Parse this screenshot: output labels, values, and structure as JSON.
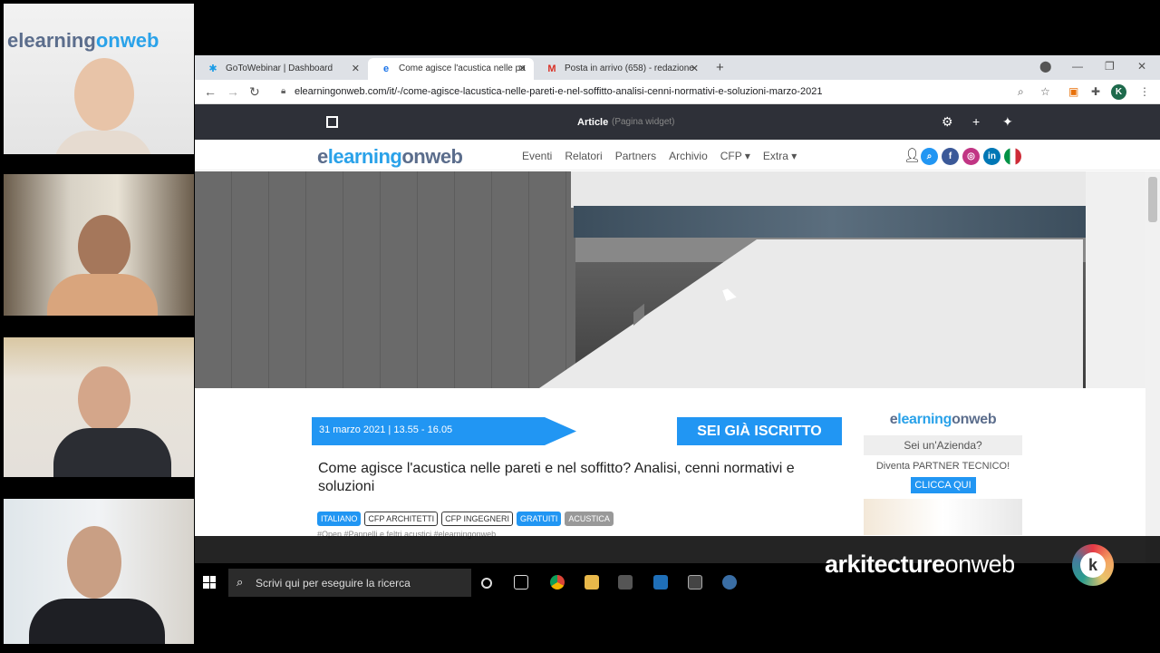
{
  "browser": {
    "tabs": [
      {
        "label": "GoToWebinar | Dashboard",
        "active": false
      },
      {
        "label": "Come agisce l'acustica nelle pa",
        "active": true
      },
      {
        "label": "Posta in arrivo (658) - redazione",
        "active": false
      }
    ],
    "url": "elearningonweb.com/it/-/come-agisce-lacustica-nelle-pareti-e-nel-soffitto-analisi-cenni-normativi-e-soluzioni-marzo-2021",
    "avatar_letter": "K"
  },
  "wp_toolbar": {
    "title": "Article",
    "subtitle": "(Pagina widget)"
  },
  "site": {
    "logo": {
      "part1": "e",
      "part2": "learning",
      "part3": "onweb"
    },
    "menu": [
      "Eventi",
      "Relatori",
      "Partners",
      "Archivio",
      "CFP ▾",
      "Extra ▾"
    ],
    "social": [
      {
        "name": "search-icon",
        "glyph": "⌕",
        "color": "#2196f3"
      },
      {
        "name": "facebook-icon",
        "glyph": "f",
        "color": "#3b5998"
      },
      {
        "name": "instagram-icon",
        "glyph": "◎",
        "color": "#c13584"
      },
      {
        "name": "linkedin-icon",
        "glyph": "in",
        "color": "#0077b5"
      }
    ]
  },
  "article": {
    "date": "31 marzo 2021 | 13.55 - 16.05",
    "cta": "SEI GIÀ ISCRITTO",
    "title": "Come agisce l'acustica nelle pareti e nel soffitto? Analisi, cenni normativi e soluzioni",
    "tags": [
      {
        "label": "ITALIANO",
        "style": "blue"
      },
      {
        "label": "CFP ARCHITETTI",
        "style": "outline"
      },
      {
        "label": "CFP INGEGNERI",
        "style": "outline"
      },
      {
        "label": "GRATUITI",
        "style": "blue"
      },
      {
        "label": "ACUSTICA",
        "style": "grey"
      }
    ],
    "hashtags": "#Open  #Pannelli e feltri acustici  #elearningonweb"
  },
  "sidebar": {
    "question": "Sei un'Azienda?",
    "text": "Diventa PARTNER TECNICO!",
    "button": "CLICCA QUI"
  },
  "taskbar": {
    "search_placeholder": "Scrivi qui per eseguire la ricerca"
  },
  "overlay": {
    "brand_bold": "arkitecture",
    "brand_light": "onweb",
    "k_letter": "k"
  },
  "cam_logo": {
    "part1": "elearning",
    "part2": "onweb"
  }
}
